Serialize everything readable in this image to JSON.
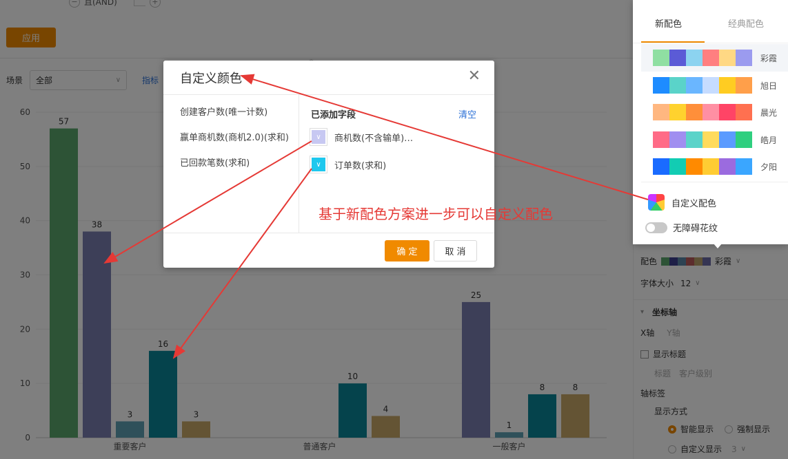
{
  "filter": {
    "and_label": "且(AND)",
    "apply_button": "应用"
  },
  "scene": {
    "label": "场景",
    "value": "全部",
    "metric_link": "指标"
  },
  "chart_data": {
    "type": "bar",
    "categories": [
      "重要客户",
      "普通客户",
      "一般客户"
    ],
    "ylim": [
      0,
      60
    ],
    "yticks": [
      0,
      10,
      20,
      30,
      40,
      50,
      60
    ],
    "series": [
      {
        "values": [
          57,
          null,
          null
        ],
        "color": "#5aa66d"
      },
      {
        "values": [
          38,
          null,
          25
        ],
        "color": "#7b7fb0"
      },
      {
        "values": [
          3,
          null,
          1
        ],
        "color": "#5fa1b5"
      },
      {
        "values": [
          16,
          10,
          8
        ],
        "color": "#0b8699"
      },
      {
        "values": [
          3,
          4,
          8
        ],
        "color": "#c8a869"
      }
    ]
  },
  "dialog": {
    "title": "自定义颜色",
    "fields": [
      "创建客户数(唯一计数)",
      "赢单商机数(商机2.0)(求和)",
      "已回款笔数(求和)"
    ],
    "added_title": "已添加字段",
    "clear_label": "清空",
    "added": [
      {
        "label": "商机数(不含输单)…",
        "color": "#c7c8f2"
      },
      {
        "label": "订单数(求和)",
        "color": "#1ec8ee"
      }
    ],
    "ok_label": "确 定",
    "cancel_label": "取 消"
  },
  "palette": {
    "tabs": [
      "新配色",
      "经典配色"
    ],
    "schemes": [
      {
        "name": "彩霞",
        "colors": [
          "#8fdfa2",
          "#5b5bd6",
          "#8cd3f0",
          "#ff7f80",
          "#ffd884",
          "#9b9bef"
        ]
      },
      {
        "name": "旭日",
        "colors": [
          "#1e8cff",
          "#5ad3c9",
          "#6ab6ff",
          "#c6dcff",
          "#ffcc22",
          "#ff9f4a"
        ]
      },
      {
        "name": "晨光",
        "colors": [
          "#ffb780",
          "#ffd22e",
          "#ff8f3a",
          "#ff8fa3",
          "#ff4466",
          "#ff7050"
        ]
      },
      {
        "name": "皓月",
        "colors": [
          "#ff6b87",
          "#a08ef0",
          "#5ad3c9",
          "#ffdb5c",
          "#5b9bff",
          "#2fcf7f"
        ]
      },
      {
        "name": "夕阳",
        "colors": [
          "#1a6bff",
          "#12ccb3",
          "#ff8a00",
          "#ffcc33",
          "#9b6bdf",
          "#3aa6ff"
        ]
      }
    ],
    "custom_label": "自定义配色",
    "accessibility_label": "无障碍花纹"
  },
  "settings": {
    "color_label": "配色",
    "color_value": "彩霞",
    "color_swatches": [
      "#5aa66d",
      "#3d3f8f",
      "#5a86a6",
      "#b85a5a",
      "#b9a06a",
      "#6a6aa6"
    ],
    "font_size_label": "字体大小",
    "font_size_value": "12",
    "axis_section": "坐标轴",
    "x_axis": "X轴",
    "y_axis": "Y轴",
    "show_title": "显示标题",
    "title_label": "标题",
    "title_value": "客户级别",
    "axis_tick_label": "轴标签",
    "display_mode": "显示方式",
    "smart_display": "智能显示",
    "force_display": "强制显示",
    "custom_display": "自定义显示",
    "custom_display_value": "3"
  },
  "annotation": "基于新配色方案进一步可以自定义配色"
}
